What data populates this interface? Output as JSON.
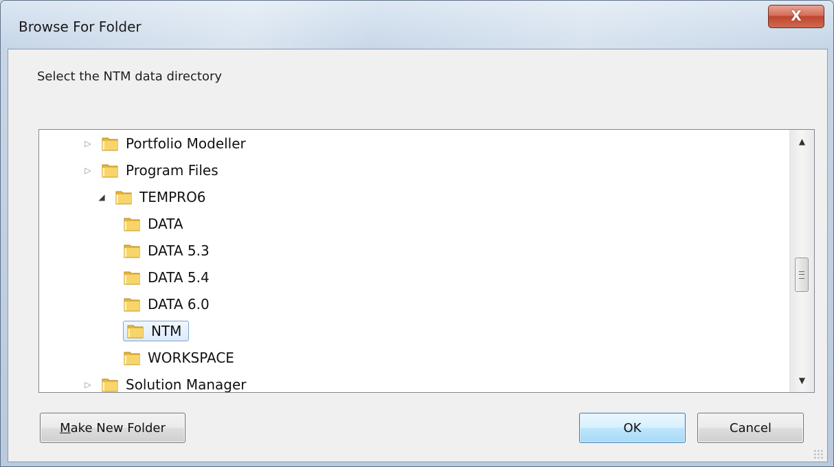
{
  "window": {
    "title": "Browse For Folder",
    "close_glyph": "X"
  },
  "instruction": "Select the NTM data directory",
  "tree": {
    "nodes": [
      {
        "label": "Portfolio Modeller",
        "level": 1,
        "expander": "collapsed",
        "selected": false
      },
      {
        "label": "Program Files",
        "level": 1,
        "expander": "collapsed",
        "selected": false
      },
      {
        "label": "TEMPRO6",
        "level": 2,
        "expander": "expanded",
        "selected": false
      },
      {
        "label": "DATA",
        "level": 3,
        "expander": "none",
        "selected": false
      },
      {
        "label": "DATA 5.3",
        "level": 3,
        "expander": "none",
        "selected": false
      },
      {
        "label": "DATA 5.4",
        "level": 3,
        "expander": "none",
        "selected": false
      },
      {
        "label": "DATA  6.0",
        "level": 3,
        "expander": "none",
        "selected": false
      },
      {
        "label": "NTM",
        "level": 3,
        "expander": "none",
        "selected": true
      },
      {
        "label": "WORKSPACE",
        "level": 3,
        "expander": "none",
        "selected": false
      },
      {
        "label": "Solution Manager",
        "level": 1,
        "expander": "collapsed",
        "selected": false
      }
    ],
    "icons": {
      "folder": "folder-icon",
      "collapsed": "triangle-right-icon",
      "expanded": "triangle-down-icon"
    }
  },
  "buttons": {
    "make_new_folder": {
      "mnemonic": "M",
      "rest": "ake New Folder"
    },
    "ok": "OK",
    "cancel": "Cancel"
  },
  "colors": {
    "close_button": "#c0452e",
    "selection_border": "#7da2ce",
    "default_button_border": "#3c7fb1",
    "folder_yellow": "#f2c94c"
  }
}
